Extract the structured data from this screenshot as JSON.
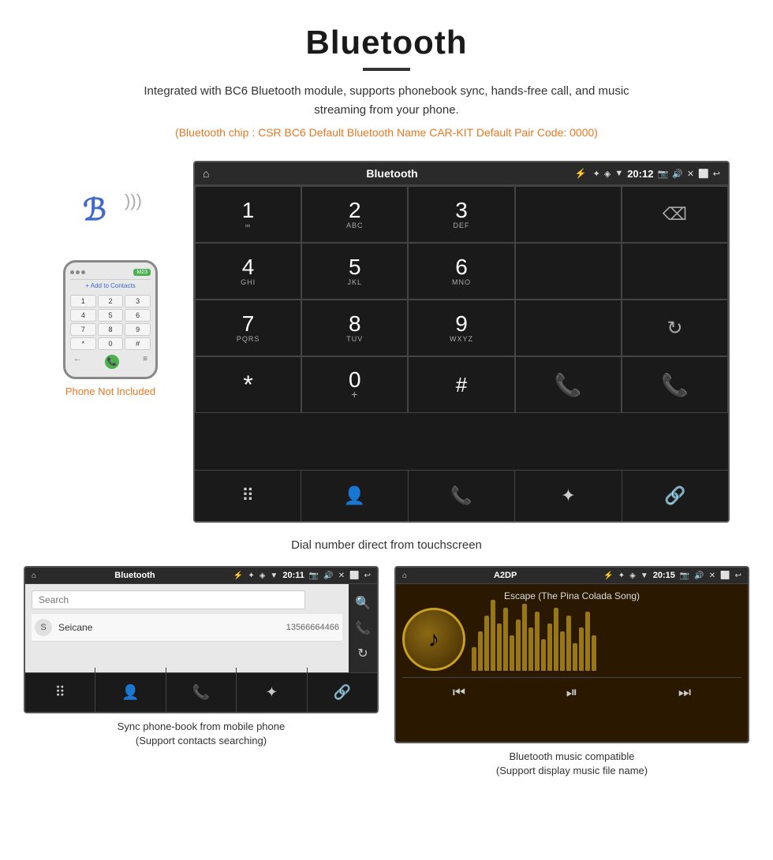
{
  "header": {
    "title": "Bluetooth",
    "description": "Integrated with BC6 Bluetooth module, supports phonebook sync, hands-free call, and music streaming from your phone.",
    "specs": "(Bluetooth chip : CSR BC6    Default Bluetooth Name CAR-KIT    Default Pair Code: 0000)"
  },
  "car_screen": {
    "status_bar": {
      "home_icon": "⌂",
      "title": "Bluetooth",
      "usb_icon": "⚡",
      "bt_icon": "✦",
      "location_icon": "◈",
      "signal_icon": "▼",
      "time": "20:12",
      "camera_icon": "📷",
      "volume_icon": "🔊",
      "close_icon": "✕",
      "rect_icon": "⬜",
      "back_icon": "↩"
    },
    "dialpad": [
      {
        "main": "1",
        "sub": "∞",
        "type": "digit"
      },
      {
        "main": "2",
        "sub": "ABC",
        "type": "digit"
      },
      {
        "main": "3",
        "sub": "DEF",
        "type": "digit"
      },
      {
        "main": "",
        "sub": "",
        "type": "empty"
      },
      {
        "main": "⌫",
        "sub": "",
        "type": "delete"
      },
      {
        "main": "4",
        "sub": "GHI",
        "type": "digit"
      },
      {
        "main": "5",
        "sub": "JKL",
        "type": "digit"
      },
      {
        "main": "6",
        "sub": "MNO",
        "type": "digit"
      },
      {
        "main": "",
        "sub": "",
        "type": "empty"
      },
      {
        "main": "",
        "sub": "",
        "type": "empty"
      },
      {
        "main": "7",
        "sub": "PQRS",
        "type": "digit"
      },
      {
        "main": "8",
        "sub": "TUV",
        "type": "digit"
      },
      {
        "main": "9",
        "sub": "WXYZ",
        "type": "digit"
      },
      {
        "main": "",
        "sub": "",
        "type": "empty"
      },
      {
        "main": "↻",
        "sub": "",
        "type": "refresh"
      },
      {
        "main": "*",
        "sub": "",
        "type": "symbol"
      },
      {
        "main": "0",
        "sub": "+",
        "type": "zero"
      },
      {
        "main": "#",
        "sub": "",
        "type": "symbol"
      },
      {
        "main": "📞",
        "sub": "",
        "type": "call-green"
      },
      {
        "main": "📞",
        "sub": "",
        "type": "call-red"
      }
    ],
    "bottom_bar": [
      {
        "icon": "⠿",
        "name": "dialpad"
      },
      {
        "icon": "👤",
        "name": "contacts"
      },
      {
        "icon": "📞",
        "name": "phone"
      },
      {
        "icon": "✦",
        "name": "bluetooth"
      },
      {
        "icon": "🔗",
        "name": "link"
      }
    ]
  },
  "phone_aside": {
    "bt_symbol": "ℬ",
    "signal_waves": "))))",
    "not_included_text": "Phone Not Included",
    "phone_dialpad_keys": [
      "1",
      "2",
      "3",
      "4",
      "5",
      "6",
      "7",
      "8",
      "9",
      "*",
      "0",
      "#"
    ],
    "add_contact": "+ Add to Contacts"
  },
  "main_caption": "Dial number direct from touchscreen",
  "phonebook_screen": {
    "status_bar": {
      "home_icon": "⌂",
      "title": "Bluetooth",
      "time": "20:11"
    },
    "search_placeholder": "Search",
    "contact": {
      "initial": "S",
      "name": "Seicane",
      "number": "13566664466"
    },
    "sidebar_icons": [
      "🔍",
      "📞",
      "↻"
    ]
  },
  "music_screen": {
    "status_bar": {
      "home_icon": "⌂",
      "title": "A2DP",
      "time": "20:15"
    },
    "song_title": "Escape (The Pina Colada Song)",
    "music_icon": "♪",
    "bt_icon": "✦",
    "viz_bars": [
      30,
      50,
      70,
      90,
      60,
      80,
      45,
      65,
      85,
      55,
      75,
      40,
      60,
      80,
      50,
      70,
      35,
      55,
      75,
      45
    ],
    "controls": [
      "⏮",
      "⏯",
      "⏭"
    ]
  },
  "captions": {
    "phonebook": "Sync phone-book from mobile phone\n(Support contacts searching)",
    "music": "Bluetooth music compatible\n(Support display music file name)"
  }
}
